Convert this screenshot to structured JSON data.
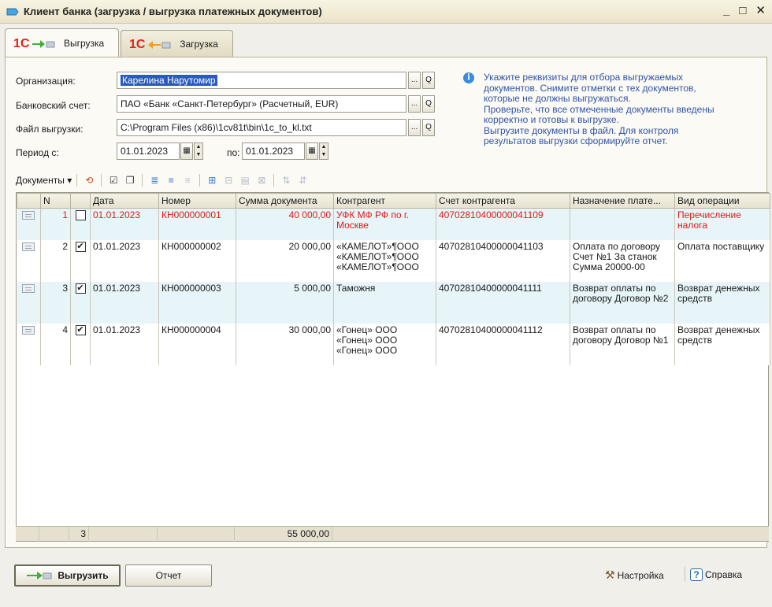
{
  "window": {
    "title": "Клиент банка (загрузка / выгрузка платежных документов)",
    "minimize": "_",
    "maximize": "□",
    "close": "✕"
  },
  "tabs": [
    {
      "label": "Выгрузка",
      "active": true
    },
    {
      "label": "Загрузка",
      "active": false
    }
  ],
  "form": {
    "org_label": "Организация:",
    "org_value": "Карелина Нарутомир",
    "account_label": "Банковский счет:",
    "account_value": "ПАО «Банк «Санкт-Петербург» (Расчетный, EUR)",
    "file_label": "Файл выгрузки:",
    "file_value": "C:\\Program Files (x86)\\1cv81t\\bin\\1c_to_kl.txt",
    "period_label": "Период с:",
    "period_from": "01.01.2023",
    "period_to_label": "по:",
    "period_to": "01.01.2023",
    "select_btn": "...",
    "open_btn": "Q"
  },
  "info": {
    "lines": [
      "Укажите реквизиты для отбора выгружаемых",
      "документов. Снимите отметки с тех документов,",
      "которые не должны выгружаться.",
      "Проверьте, что все отмеченные документы введены",
      "корректно и готовы к выгрузке.",
      "Выгрузите документы в файл. Для контроля",
      "результатов выгрузки сформируйте отчет."
    ]
  },
  "toolbar": {
    "documents_label": "Документы ▾"
  },
  "table": {
    "headers": [
      "",
      "N",
      "",
      "Дата",
      "Номер",
      "Сумма документа",
      "Контрагент",
      "Счет контрагента",
      "Назначение плате...",
      "Вид операции"
    ],
    "rows": [
      {
        "n": "1",
        "checked": "",
        "date": "01.01.2023",
        "number": "КН000000001",
        "sum": "40 000,00",
        "contractor": "УФК МФ РФ по г. Москве",
        "account": "40702810400000041109",
        "purpose": "",
        "operation": "Перечисление налога"
      },
      {
        "n": "2",
        "checked": "✔",
        "date": "01.01.2023",
        "number": "КН000000002",
        "sum": "20 000,00",
        "contractor": "«КАМЕЛОТ»¶ООО «КАМЕЛОТ»¶ООО «КАМЕЛОТ»¶ООО",
        "account": "40702810400000041103",
        "purpose": "Оплата по договору Счет №1 За станок Сумма 20000-00",
        "operation": "Оплата поставщику"
      },
      {
        "n": "3",
        "checked": "✔",
        "date": "01.01.2023",
        "number": "КН000000003",
        "sum": "5 000,00",
        "contractor": "Таможня",
        "account": "40702810400000041111",
        "purpose": "Возврат оплаты по договору Договор №2",
        "operation": "Возврат денежных средств"
      },
      {
        "n": "4",
        "checked": "✔",
        "date": "01.01.2023",
        "number": "КН000000004",
        "sum": "30 000,00",
        "contractor": "«Гонец» ООО «Гонец» ООО «Гонец» ООО",
        "account": "40702810400000041112",
        "purpose": "Возврат оплаты по договору Договор №1",
        "operation": "Возврат денежных средств"
      }
    ],
    "footer": {
      "checked_count": "3",
      "total_sum": "55 000,00"
    }
  },
  "buttons": {
    "export": "Выгрузить",
    "report": "Отчет",
    "settings": "Настройка",
    "help": "Справка"
  }
}
